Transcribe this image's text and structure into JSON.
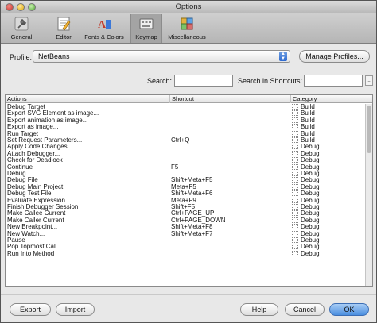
{
  "window": {
    "title": "Options"
  },
  "toolbar": {
    "tabs": [
      {
        "label": "General",
        "icon": "wrench-icon"
      },
      {
        "label": "Editor",
        "icon": "editor-icon"
      },
      {
        "label": "Fonts & Colors",
        "icon": "fonts-colors-icon"
      },
      {
        "label": "Keymap",
        "icon": "keymap-icon",
        "active": true
      },
      {
        "label": "Miscellaneous",
        "icon": "miscellaneous-icon"
      }
    ]
  },
  "profile": {
    "label": "Profile:",
    "value": "NetBeans",
    "manage_button": "Manage Profiles..."
  },
  "search": {
    "label": "Search:",
    "value": "",
    "shortcuts_label": "Search in Shortcuts:",
    "shortcuts_value": "",
    "more_button": "..."
  },
  "table": {
    "headers": [
      "Actions",
      "Shortcut",
      "Category"
    ],
    "rows": [
      {
        "action": "Debug Target",
        "shortcut": "",
        "category": "Build"
      },
      {
        "action": "Export SVG Element as image...",
        "shortcut": "",
        "category": "Build"
      },
      {
        "action": "Export animation as image...",
        "shortcut": "",
        "category": "Build"
      },
      {
        "action": "Export as image...",
        "shortcut": "",
        "category": "Build"
      },
      {
        "action": "Run Target",
        "shortcut": "",
        "category": "Build"
      },
      {
        "action": "Set Request Parameters...",
        "shortcut": "Ctrl+Q",
        "category": "Build"
      },
      {
        "action": "Apply Code Changes",
        "shortcut": "",
        "category": "Debug"
      },
      {
        "action": "Attach Debugger...",
        "shortcut": "",
        "category": "Debug"
      },
      {
        "action": "Check for Deadlock",
        "shortcut": "",
        "category": "Debug"
      },
      {
        "action": "Continue",
        "shortcut": "F5",
        "category": "Debug"
      },
      {
        "action": "Debug",
        "shortcut": "",
        "category": "Debug"
      },
      {
        "action": "Debug File",
        "shortcut": "Shift+Meta+F5",
        "category": "Debug"
      },
      {
        "action": "Debug Main Project",
        "shortcut": "Meta+F5",
        "category": "Debug"
      },
      {
        "action": "Debug Test File",
        "shortcut": "Shift+Meta+F6",
        "category": "Debug"
      },
      {
        "action": "Evaluate Expression...",
        "shortcut": "Meta+F9",
        "category": "Debug"
      },
      {
        "action": "Finish Debugger Session",
        "shortcut": "Shift+F5",
        "category": "Debug"
      },
      {
        "action": "Make Callee Current",
        "shortcut": "Ctrl+PAGE_UP",
        "category": "Debug"
      },
      {
        "action": "Make Caller Current",
        "shortcut": "Ctrl+PAGE_DOWN",
        "category": "Debug"
      },
      {
        "action": "New Breakpoint...",
        "shortcut": "Shift+Meta+F8",
        "category": "Debug"
      },
      {
        "action": "New Watch...",
        "shortcut": "Shift+Meta+F7",
        "category": "Debug"
      },
      {
        "action": "Pause",
        "shortcut": "",
        "category": "Debug"
      },
      {
        "action": "Pop Topmost Call",
        "shortcut": "",
        "category": "Debug"
      },
      {
        "action": "Run Into Method",
        "shortcut": "",
        "category": "Debug"
      }
    ]
  },
  "footer": {
    "export": "Export",
    "import": "Import",
    "help": "Help",
    "cancel": "Cancel",
    "ok": "OK"
  }
}
